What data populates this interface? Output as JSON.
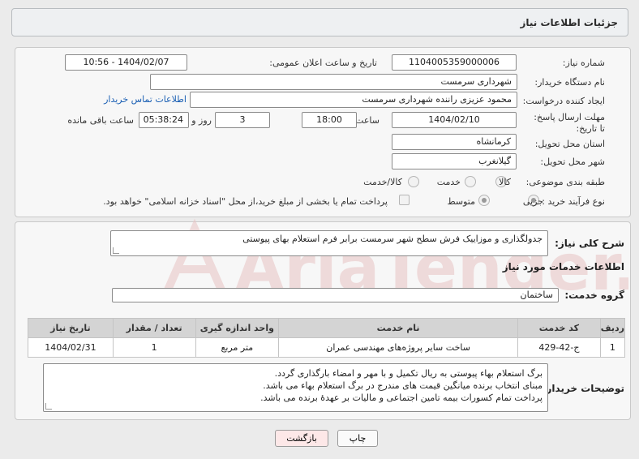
{
  "header": {
    "title": "جزئیات اطلاعات نیاز"
  },
  "fields": {
    "need_number_label": "شماره نیاز:",
    "need_number": "1104005359000006",
    "announce_label": "تاریخ و ساعت اعلان عمومی:",
    "announce_value": "1404/02/07 - 10:56",
    "buyer_org_label": "نام دستگاه خریدار:",
    "buyer_org": "شهرداری سرمست",
    "creator_label": "ایجاد کننده درخواست:",
    "creator": "محمود عزیزی راننده شهرداری سرمست",
    "contact_link": "اطلاعات تماس خریدار",
    "deadline_label": "مهلت ارسال پاسخ: تا تاریخ:",
    "deadline_date": "1404/02/10",
    "time_label": "ساعت",
    "deadline_time": "18:00",
    "days_value": "3",
    "days_label": "روز و",
    "remaining_time": "05:38:24",
    "remaining_label": "ساعت باقی مانده",
    "province_label": "استان محل تحویل:",
    "province": "کرمانشاه",
    "city_label": "شهر محل تحویل:",
    "city": "گیلانغرب",
    "category_label": "طبقه بندی موضوعی:",
    "category_options": [
      "کالا",
      "خدمت",
      "کالا/خدمت"
    ],
    "process_label": "نوع فرآیند خرید :",
    "process_options": [
      "جزیی",
      "متوسط"
    ],
    "payment_note": "پرداخت تمام یا بخشی از مبلغ خرید،از محل \"اسناد خزانه اسلامی\" خواهد بود."
  },
  "general_desc": {
    "label": "شرح کلی نیاز:",
    "text": "جدولگذاری و موزاییک فرش سطح شهر سرمست برابر فرم استعلام بهای پیوستی"
  },
  "services": {
    "section_title": "اطلاعات خدمات مورد نیاز",
    "group_label": "گروه خدمت:",
    "group_value": "ساختمان",
    "columns": [
      "ردیف",
      "کد خدمت",
      "نام خدمت",
      "واحد اندازه گیری",
      "تعداد / مقدار",
      "تاریخ نیاز"
    ],
    "rows": [
      {
        "index": "1",
        "code": "ج-42-429",
        "name": "ساخت سایر پروژه‌های مهندسی عمران",
        "unit": "متر مربع",
        "qty": "1",
        "date": "1404/02/31"
      }
    ]
  },
  "buyer_notes": {
    "label": "توضیحات خریدار:",
    "lines": [
      "برگ استعلام بهاء پیوستی به ریال تکمیل و با مهر و امضاء بارگذاری گردد.",
      "مبنای انتخاب برنده میانگین قیمت های مندرج در برگ استعلام بهاء می باشد.",
      "پرداخت تمام کسورات بیمه تامین اجتماعی و مالیات بر عهدهٔ برنده می باشد."
    ]
  },
  "buttons": {
    "print": "چاپ",
    "back": "بازگشت"
  },
  "watermark": {
    "text": "AriaTender.net"
  },
  "colors": {
    "link": "#1a5fb4",
    "back_button": "#fde8e8",
    "watermark": "#e0b0b0"
  }
}
